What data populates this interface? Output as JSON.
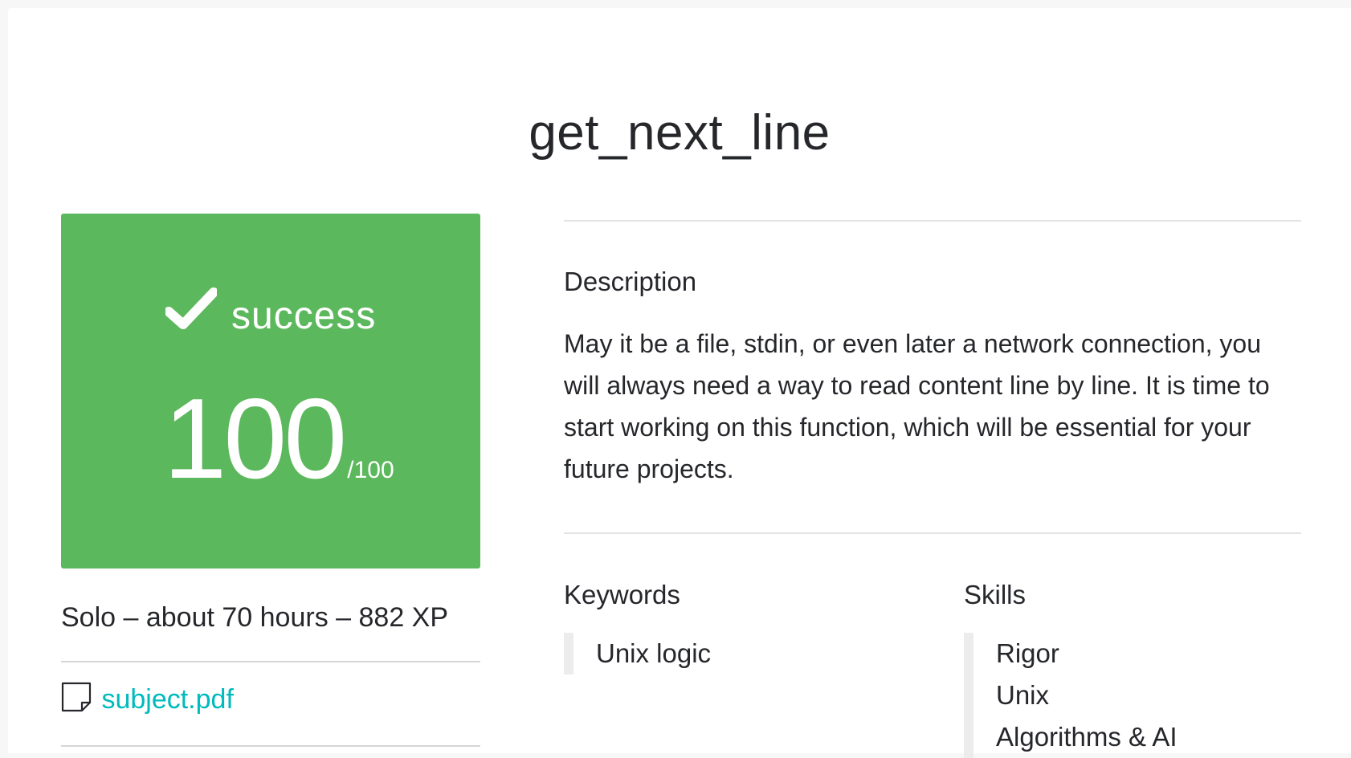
{
  "project": {
    "title": "get_next_line"
  },
  "result": {
    "status": "success",
    "score": "100",
    "score_max": "/100",
    "color": "#5cb85c"
  },
  "meta": {
    "summary": "Solo – about 70 hours – 882 XP"
  },
  "attachment": {
    "icon": "document-icon",
    "label": "subject.pdf",
    "color": "#00babc"
  },
  "description": {
    "heading": "Description",
    "text": "May it be a file, stdin, or even later a network connection, you will always need a way to read content line by line. It is time to start working on this function, which will be essential for your future projects."
  },
  "keywords": {
    "heading": "Keywords",
    "items": [
      "Unix logic"
    ]
  },
  "skills": {
    "heading": "Skills",
    "items": [
      "Rigor",
      "Unix",
      "Algorithms & AI"
    ]
  }
}
